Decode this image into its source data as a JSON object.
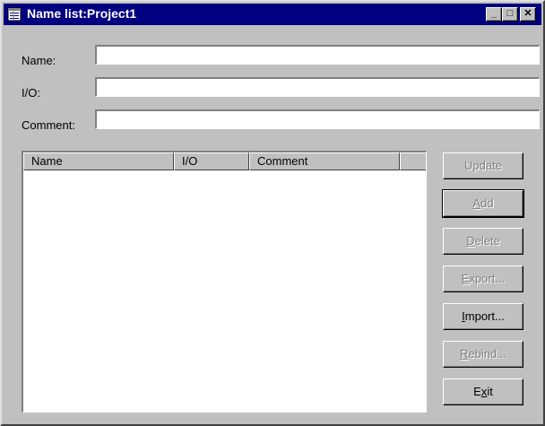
{
  "window": {
    "title": "Name list:Project1",
    "controls": {
      "minimize": "_",
      "maximize": "□",
      "close": "✕"
    }
  },
  "form": {
    "name_label": "Name:",
    "io_label": "I/O:",
    "comment_label": "Comment:",
    "name_value": "",
    "io_value": "",
    "comment_value": ""
  },
  "list": {
    "columns": [
      "Name",
      "I/O",
      "Comment",
      ""
    ],
    "rows": []
  },
  "buttons": {
    "update": {
      "pre": "Update",
      "acc": "",
      "post": "",
      "enabled": false
    },
    "add": {
      "pre": "",
      "acc": "A",
      "post": "dd",
      "enabled": false
    },
    "delete": {
      "pre": "",
      "acc": "D",
      "post": "elete",
      "enabled": false
    },
    "export": {
      "pre": "",
      "acc": "E",
      "post": "xport...",
      "enabled": false
    },
    "import": {
      "pre": "",
      "acc": "I",
      "post": "mport...",
      "enabled": true
    },
    "rebind": {
      "pre": "",
      "acc": "R",
      "post": "ebind...",
      "enabled": false
    },
    "exit": {
      "pre": "E",
      "acc": "x",
      "post": "it",
      "enabled": true
    }
  },
  "colors": {
    "titlebar": "#000080",
    "face": "#c0c0c0",
    "disabled_text": "#808080"
  },
  "icons": [
    "app-list-icon",
    "minimize-icon",
    "maximize-icon",
    "close-icon"
  ]
}
